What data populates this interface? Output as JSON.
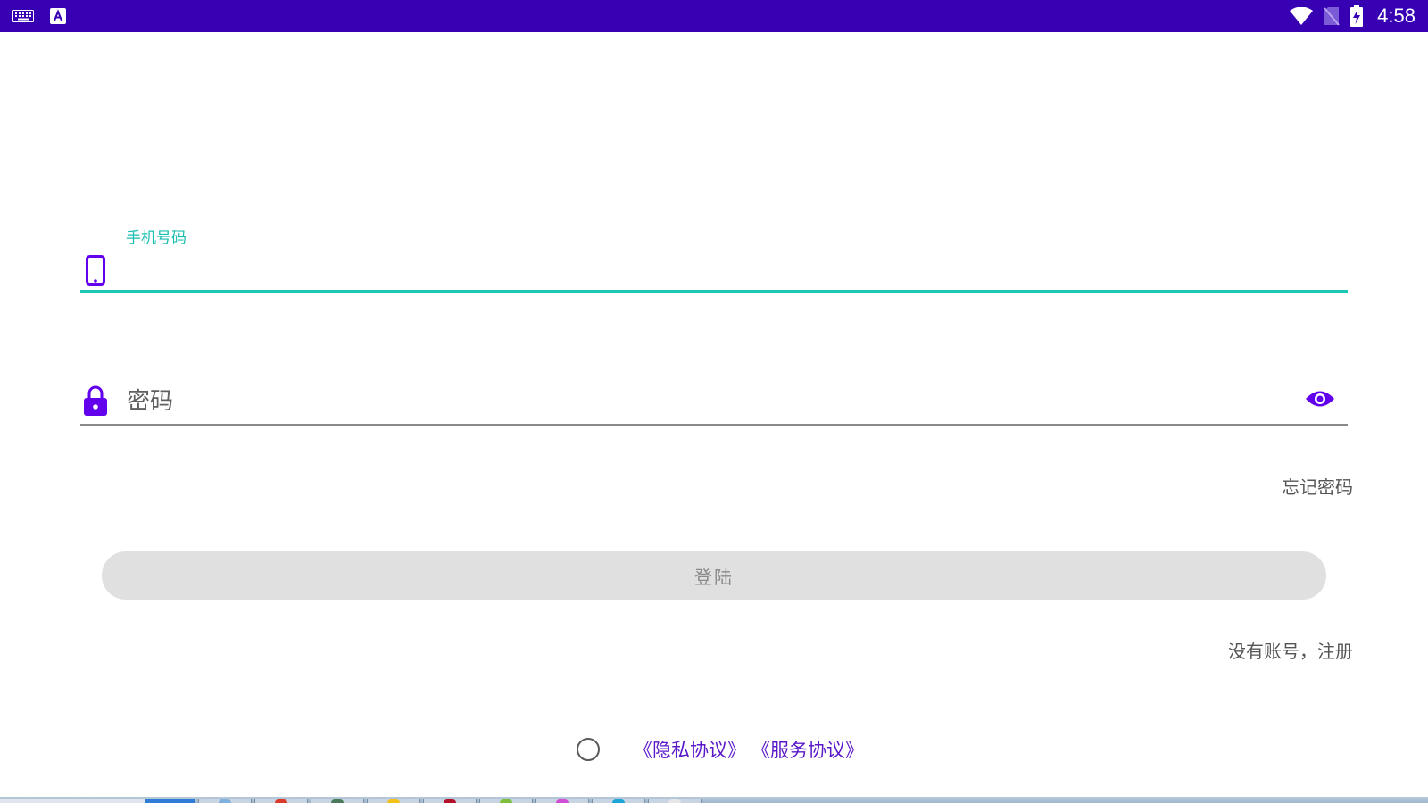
{
  "status_bar": {
    "time": "4:58",
    "icons": [
      "keyboard-icon",
      "font-a-icon",
      "wifi-icon",
      "no-sim-icon",
      "battery-charging-icon"
    ],
    "background": "#3700b3"
  },
  "login_form": {
    "phone": {
      "label": "手机号码",
      "value": "",
      "icon": "smartphone-icon",
      "accent": "#1ec6b6"
    },
    "password": {
      "placeholder": "密码",
      "value": "",
      "icon": "lock-icon",
      "toggle_icon": "eye-icon"
    },
    "forgot_password": "忘记密码",
    "login_button": "登陆",
    "register": "没有账号，注册",
    "agreement": {
      "privacy": "《隐私协议》",
      "service": "《服务协议》",
      "checked": false
    }
  },
  "colors": {
    "primary": "#6200ee",
    "primary_dark": "#3700b3",
    "accent": "#1ec6b6",
    "link": "#5a18c9"
  }
}
